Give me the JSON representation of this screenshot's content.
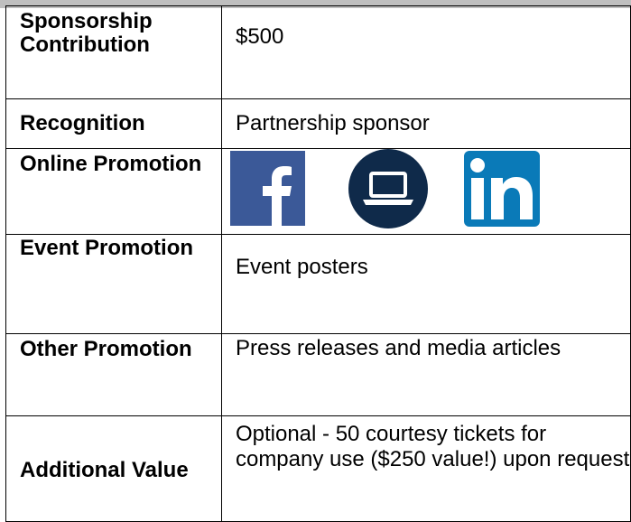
{
  "table": {
    "rows": [
      {
        "label": "Sponsorship Contribution",
        "value": "$500"
      },
      {
        "label": "Recognition",
        "value": "Partnership sponsor"
      },
      {
        "label": "Online Promotion",
        "icons": [
          "facebook-icon",
          "laptop-icon",
          "linkedin-icon"
        ]
      },
      {
        "label": "Event Promotion",
        "value": "Event posters"
      },
      {
        "label": "Other Promotion",
        "value": "Press releases and media articles"
      },
      {
        "label": "Additional Value",
        "value": "Optional - 50 courtesy tickets for company use ($250 value!) upon request"
      }
    ]
  },
  "colors": {
    "facebook": "#3b5998",
    "laptop_circle": "#0f2a4a",
    "linkedin": "#0a7ab8",
    "top_band": "#bfbfbf"
  }
}
